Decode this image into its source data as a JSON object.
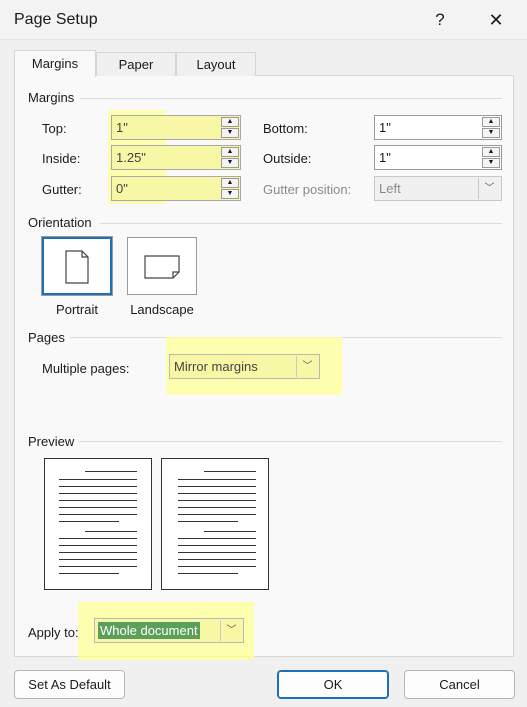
{
  "window": {
    "title": "Page Setup",
    "help": "?",
    "close": "✕"
  },
  "tabs": [
    {
      "label": "Margins",
      "active": true
    },
    {
      "label": "Paper",
      "active": false
    },
    {
      "label": "Layout",
      "active": false
    }
  ],
  "margins": {
    "section": "Margins",
    "top": {
      "label": "Top:",
      "value": "1\""
    },
    "bottom": {
      "label": "Bottom:",
      "value": "1\""
    },
    "inside": {
      "label": "Inside:",
      "value": "1.25\""
    },
    "outside": {
      "label": "Outside:",
      "value": "1\""
    },
    "gutter": {
      "label": "Gutter:",
      "value": "0\""
    },
    "gutter_position": {
      "label": "Gutter position:",
      "value": "Left"
    }
  },
  "orientation": {
    "section": "Orientation",
    "portrait": "Portrait",
    "landscape": "Landscape",
    "selected": "portrait"
  },
  "pages": {
    "section": "Pages",
    "multiple_label": "Multiple pages:",
    "multiple_value": "Mirror margins"
  },
  "preview": {
    "section": "Preview"
  },
  "apply": {
    "label": "Apply to:",
    "value": "Whole document"
  },
  "buttons": {
    "set_default": "Set As Default",
    "ok": "OK",
    "cancel": "Cancel"
  },
  "colors": {
    "highlight": "#ffff96",
    "accent": "#1e6fb8",
    "selection": "#5aa05a"
  }
}
